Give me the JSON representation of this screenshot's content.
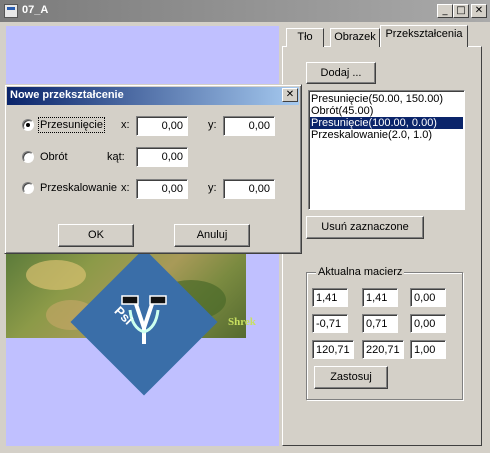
{
  "window": {
    "title": "07_A",
    "min_glyph": "_",
    "max_glyph": "□",
    "close_glyph": "✕"
  },
  "canvas": {
    "logo_text": "Shrek",
    "psi_label": "Psi"
  },
  "tabs": [
    {
      "label": "Tło"
    },
    {
      "label": "Obrazek"
    },
    {
      "label": "Przekształcenia"
    }
  ],
  "transforms_tab": {
    "add_label": "Dodaj ...",
    "list": [
      {
        "text": "Presunięcie(50.00, 150.00)",
        "selected": false
      },
      {
        "text": "Obrót(45.00)",
        "selected": false
      },
      {
        "text": "Presunięcie(100.00, 0.00)",
        "selected": true
      },
      {
        "text": "Przeskalowanie(2.0, 1.0)",
        "selected": false
      }
    ],
    "remove_label": "Usuń zaznaczone",
    "matrix_group_label": "Aktualna macierz",
    "matrix": [
      [
        "1,41",
        "1,41",
        "0,00"
      ],
      [
        "-0,71",
        "0,71",
        "0,00"
      ],
      [
        "120,71",
        "220,71",
        "1,00"
      ]
    ],
    "apply_label": "Zastosuj"
  },
  "dialog": {
    "title": "Nowe przekształcenie",
    "close_glyph": "✕",
    "rows": [
      {
        "option": "Przesunięcie",
        "checked": true,
        "label1": "x:",
        "value1": "0,00",
        "label2": "y:",
        "value2": "0,00"
      },
      {
        "option": "Obrót",
        "checked": false,
        "label1": "kąt:",
        "value1": "0,00"
      },
      {
        "option": "Przeskalowanie",
        "checked": false,
        "label1": "x:",
        "value1": "0,00",
        "label2": "y:",
        "value2": "0,00"
      }
    ],
    "ok_label": "OK",
    "cancel_label": "Anuluj"
  }
}
